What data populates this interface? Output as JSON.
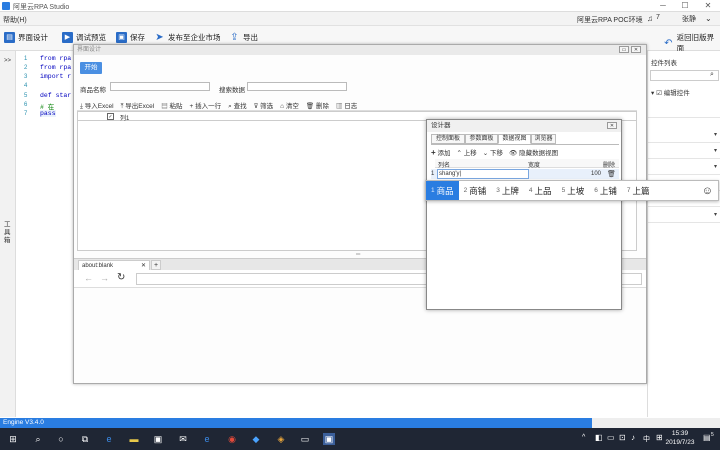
{
  "window": {
    "title": "阿里云RPA Studio",
    "min": "─",
    "max": "☐",
    "close": "✕"
  },
  "menubar": {
    "help": "帮助(H)",
    "env": "阿里云RPA POC环境",
    "user_count": "7",
    "user": "张静"
  },
  "toolbar": {
    "ui_design": "界面设计",
    "debug_preview": "调试预览",
    "save": "保存",
    "publish": "发布至企业市场",
    "export": "导出",
    "back": "返回旧版",
    "ui": "界面"
  },
  "left_strip": {
    "collapse": ">>",
    "toolbox": "工具箱"
  },
  "code": {
    "line_numbers": [
      "1",
      "2",
      "3",
      "4",
      "5",
      "6",
      "7"
    ],
    "lines": [
      "from rpa",
      "from rpa",
      "import r",
      "",
      "def star",
      "    # 在",
      "    pass"
    ]
  },
  "ui_designer_window": {
    "title": "界面设计",
    "start_button": "开始",
    "product_name_label": "商品名称",
    "search_data_label": "搜索数据",
    "grid_toolbar": [
      "导入Excel",
      "导出Excel",
      "粘贴",
      "插入一行",
      "查找",
      "筛选",
      "清空",
      "删除",
      "日志"
    ],
    "grid_column": "列1",
    "browser_tab": "about:blank",
    "new_tab": "+"
  },
  "designer_panel": {
    "title": "设计器",
    "close": "✕",
    "tabs": [
      "控制面板",
      "参数面板",
      "数据视图",
      "浏览器"
    ],
    "active_tab": 2,
    "toolbar": {
      "add": "添加",
      "up": "上移",
      "down": "下移",
      "hide": "隐藏数据视图"
    },
    "columns": {
      "name": "列名",
      "width": "宽度",
      "delete": "删除"
    },
    "row": {
      "index": "1",
      "name": "shang'y|",
      "width": "100"
    }
  },
  "ime": {
    "candidates": [
      {
        "n": "1",
        "text": "商品"
      },
      {
        "n": "2",
        "text": "商铺"
      },
      {
        "n": "3",
        "text": "上牌"
      },
      {
        "n": "4",
        "text": "上品"
      },
      {
        "n": "5",
        "text": "上坡"
      },
      {
        "n": "6",
        "text": "上铺"
      },
      {
        "n": "7",
        "text": "上篇"
      }
    ],
    "emoji": "☺"
  },
  "right_panel": {
    "title": "控件列表",
    "edit": "编辑控件"
  },
  "status": {
    "engine": "Engine V3.4.0"
  },
  "taskbar": {
    "time": "15:39",
    "date": "2019/7/23",
    "lang": "中",
    "notify_count": "5"
  },
  "colors": {
    "accent": "#2a7de1",
    "taskbar": "#1f2634"
  }
}
